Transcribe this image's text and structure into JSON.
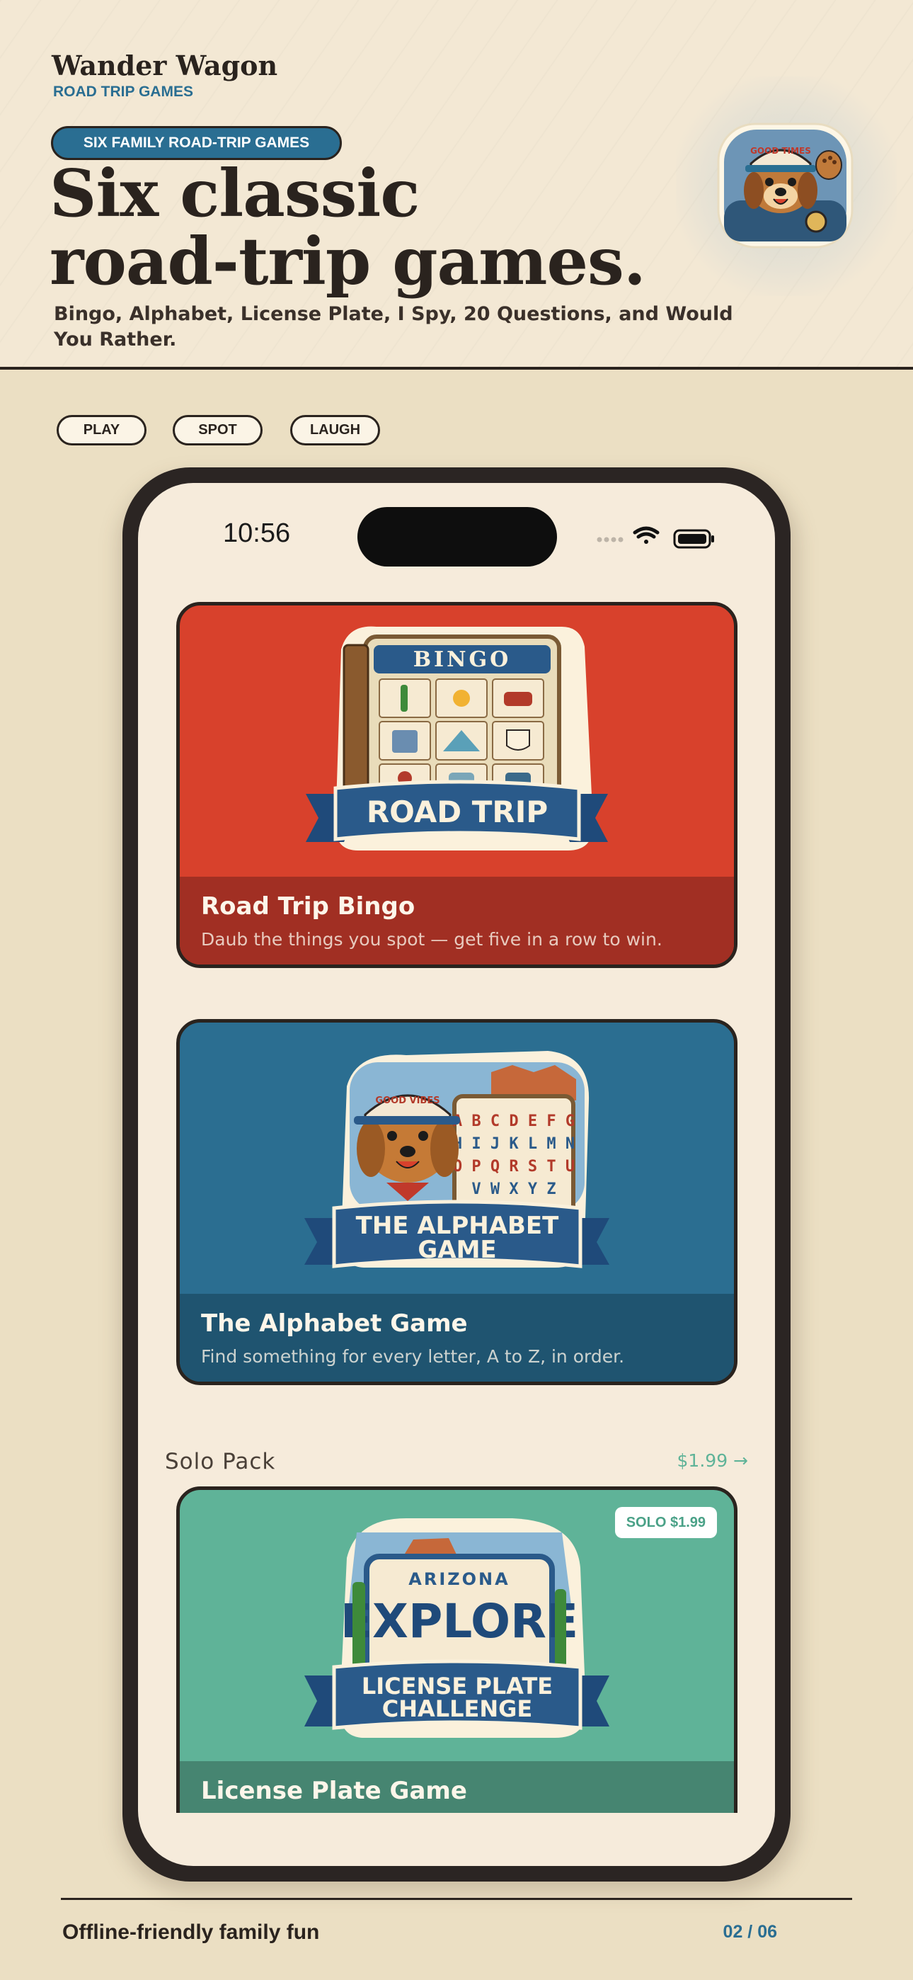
{
  "brand": {
    "name": "Wander Wagon",
    "tagline": "ROAD TRIP GAMES"
  },
  "hero": {
    "pill": "SIX FAMILY ROAD-TRIP GAMES",
    "headline_line1": "Six classic",
    "headline_line2": "road-trip games.",
    "subline": "Bingo, Alphabet, License Plate, I Spy, 20 Questions, and Would You Rather.",
    "mascot_icon": "dog-mascot-icon",
    "mascot_cap_text": "GOOD TIMES"
  },
  "chips": [
    "PLAY",
    "SPOT",
    "LAUGH"
  ],
  "phone": {
    "status": {
      "time": "10:56"
    },
    "cards": [
      {
        "title": "Road Trip Bingo",
        "description": "Daub the things you spot — get five in a row to win.",
        "art_banner": "ROAD TRIP",
        "art_header": "BINGO",
        "color": "#d8412c",
        "footer_color": "#a12f23"
      },
      {
        "title": "The Alphabet Game",
        "description": "Find something for every letter, A to Z, in order.",
        "art_banner_line1": "THE ALPHABET",
        "art_banner_line2": "GAME",
        "art_letters": [
          "A B C D E F G",
          "H I J K L M N",
          "O P Q R S T U",
          "V W X Y Z"
        ],
        "art_cap_text": "GOOD VIBES",
        "color": "#2b6e91",
        "footer_color": "#1f5470"
      },
      {
        "title": "License Plate Game",
        "badge": "SOLO $1.99",
        "art_state": "ARIZONA",
        "art_word": "EXPLORE",
        "art_banner_line1": "LICENSE PLATE",
        "art_banner_line2": "CHALLENGE",
        "color": "#5fb398",
        "footer_color": "#468571"
      }
    ],
    "section": {
      "label": "Solo Pack",
      "price": "$1.99 →"
    }
  },
  "footer": {
    "left": "Offline-friendly family fun",
    "right": "02 / 06"
  },
  "colors": {
    "ink": "#2a231e",
    "blue": "#2a6e92",
    "cream": "#f3e8d4",
    "teal": "#5fb398",
    "red": "#d8412c"
  }
}
